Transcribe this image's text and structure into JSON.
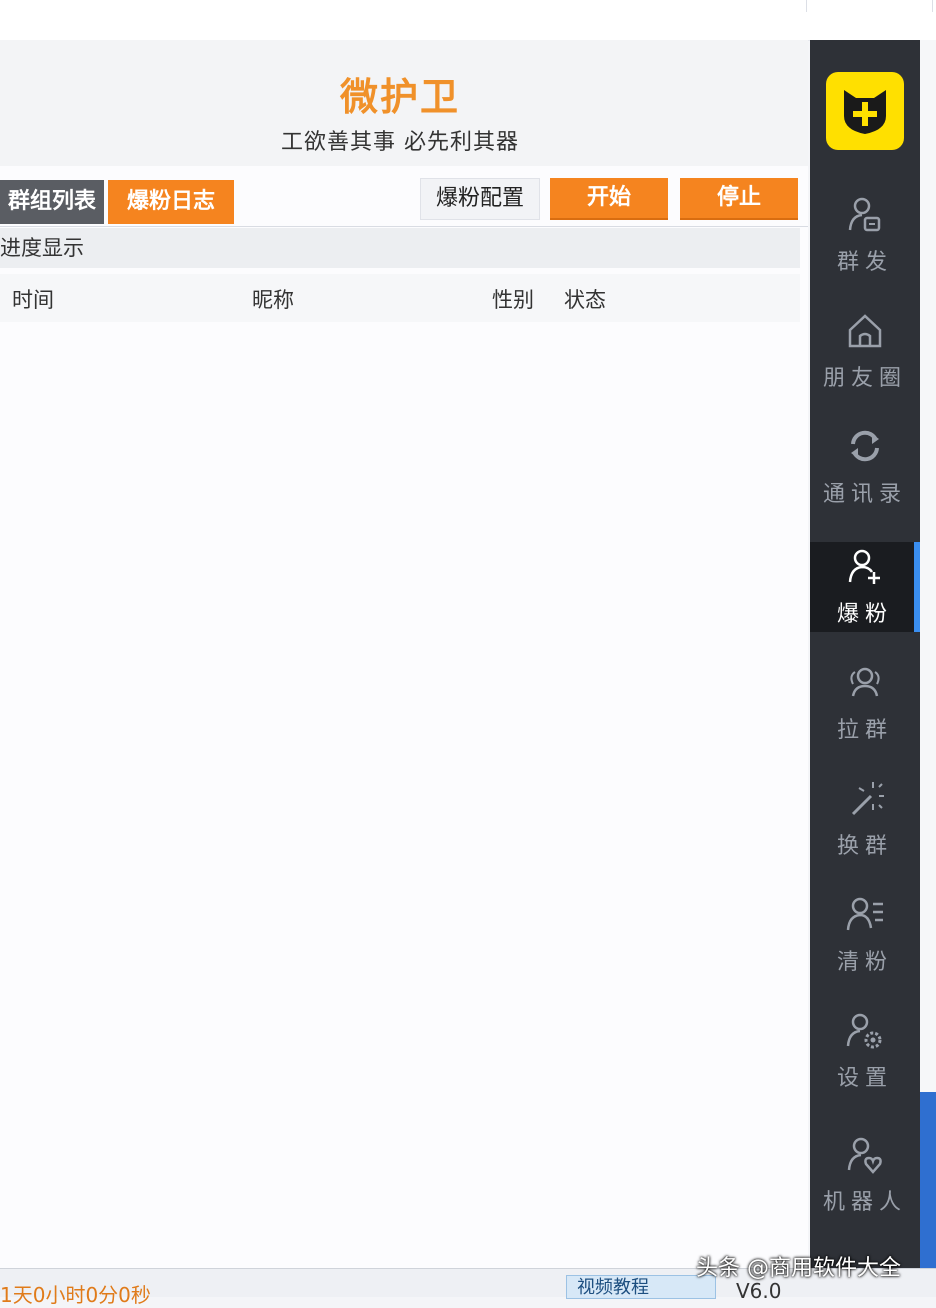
{
  "app": {
    "title": "微护卫",
    "slogan": "工欲善其事  必先利其器"
  },
  "tabs": {
    "groups": "群组列表",
    "log": "爆粉日志"
  },
  "toolbar": {
    "config": "爆粉配置",
    "start": "开始",
    "stop": "停止"
  },
  "progress": {
    "label": "进度显示"
  },
  "table": {
    "columns": [
      "时间",
      "昵称",
      "性别",
      "状态"
    ],
    "rows": []
  },
  "sidebar": {
    "items": [
      {
        "label": "群发",
        "icon": "user-message-icon"
      },
      {
        "label": "朋友圈",
        "icon": "home-icon"
      },
      {
        "label": "通讯录",
        "icon": "sync-icon"
      },
      {
        "label": "爆粉",
        "icon": "add-user-icon",
        "active": true
      },
      {
        "label": "拉群",
        "icon": "group-icon"
      },
      {
        "label": "换群",
        "icon": "magic-wand-icon"
      },
      {
        "label": "清粉",
        "icon": "user-list-icon"
      },
      {
        "label": "设置",
        "icon": "user-gear-icon"
      },
      {
        "label": "机器人",
        "icon": "user-heart-icon"
      }
    ]
  },
  "footer": {
    "status": "1天0小时0分0秒",
    "video_button": "视频教程",
    "version": "V6.0"
  },
  "watermark": "头条 @商用软件大全",
  "colors": {
    "accent": "#f5841f",
    "sidebar": "#2e3137",
    "logo": "#ffe000",
    "active_indicator": "#3a8ef0"
  }
}
